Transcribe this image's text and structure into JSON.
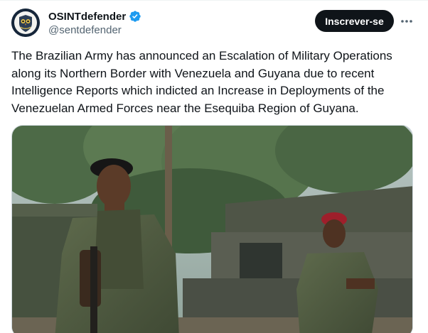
{
  "author": {
    "display_name": "OSINTdefender",
    "handle": "@sentdefender",
    "avatar_icon": "owl-shield-avatar-icon",
    "verified_icon": "verified-badge-icon",
    "verified_color": "#1d9bf0"
  },
  "actions": {
    "subscribe_label": "Inscrever-se",
    "more_icon": "more-options-icon"
  },
  "tweet": {
    "text": "The Brazilian Army has announced an Escalation of Military Operations along its Northern Border with Venezuela and Guyana due to recent Intelligence Reports which indicted an Increase in Deployments of the Venezuelan Armed Forces near the Esequiba Region of Guyana."
  },
  "media": {
    "type": "photo"
  },
  "colors": {
    "text_primary": "#0f1419",
    "text_secondary": "#536471",
    "button_bg": "#0f1419",
    "button_text": "#ffffff"
  }
}
